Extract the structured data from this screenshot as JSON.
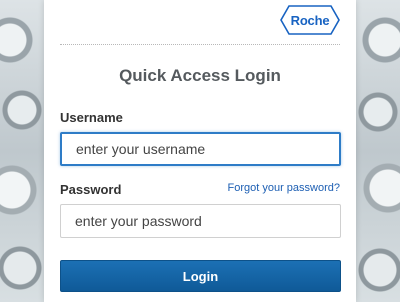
{
  "brand": {
    "logo_text": "Roche",
    "logo_color": "#1863c2"
  },
  "login": {
    "title": "Quick Access Login",
    "username_label": "Username",
    "username_placeholder": "enter your username",
    "username_value": "",
    "password_label": "Password",
    "password_placeholder": "enter your password",
    "password_value": "",
    "forgot_link": "Forgot your password?",
    "login_button": "Login"
  },
  "colors": {
    "accent": "#1c70b4",
    "link": "#1d5fb3",
    "focus_border": "#2e7cc7"
  }
}
